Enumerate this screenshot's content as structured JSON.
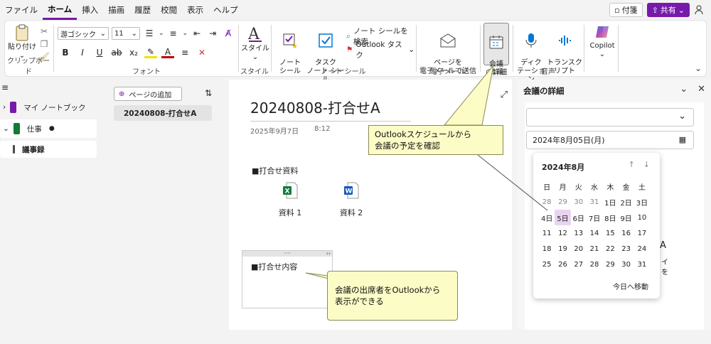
{
  "menu": {
    "items": [
      "ファイル",
      "ホーム",
      "挿入",
      "描画",
      "履歴",
      "校閲",
      "表示",
      "ヘルプ"
    ],
    "active_index": 1,
    "tag_label": "付箋",
    "share_label": "共有"
  },
  "ribbon": {
    "clipboard": {
      "paste": "貼り付け",
      "label": "クリップボード"
    },
    "font": {
      "family": "游ゴシック",
      "size": "11",
      "label": "フォント"
    },
    "style": {
      "button": "スタイル",
      "label": "スタイル"
    },
    "tags": {
      "note_tag": "ノート\nシール",
      "task_tag": "タスク\nノート シール",
      "search": "ノート シールを検索",
      "outlook_task": "Outlook タスク",
      "label": "ノート シール"
    },
    "email": {
      "button": "ページを\n電子メールで送信",
      "label": "電子メール"
    },
    "meeting": {
      "button": "会議\nの詳細",
      "label": "会議"
    },
    "voice": {
      "dictate": "ディク\nテーション",
      "transcribe": "トランスク\nリプト",
      "label": "音声"
    },
    "copilot": {
      "button": "Copilot"
    }
  },
  "nav": {
    "notebooks": [
      {
        "label": "マイ ノートブック",
        "color": "#7719aa"
      },
      {
        "label": "仕事",
        "color": "#0f7b35"
      }
    ],
    "section": "議事録",
    "section_color": "#4a4a4a"
  },
  "pages": {
    "add_label": "ページの追加",
    "items": [
      "20240808-打合せA"
    ]
  },
  "canvas": {
    "title": "20240808-打合せA",
    "date": "2025年9月7日",
    "time": "8:12",
    "section1": "■打合せ資料",
    "file1": "資料 1",
    "file2": "資料 2",
    "section2": "■打合せ内容"
  },
  "panel": {
    "title": "会議の詳細",
    "date_value": "2024年8月05日(月)",
    "partial1": "A",
    "partial2": "イ",
    "partial3": "を"
  },
  "calendar": {
    "month": "2024年8月",
    "weekdays": [
      "日",
      "月",
      "火",
      "水",
      "木",
      "金",
      "土"
    ],
    "days": [
      "28",
      "29",
      "30",
      "31",
      "1日",
      "2日",
      "3日",
      "4日",
      "5日",
      "6日",
      "7日",
      "8日",
      "9日",
      "10",
      "11",
      "12",
      "13",
      "14",
      "15",
      "16",
      "17",
      "18",
      "19",
      "20",
      "21",
      "22",
      "23",
      "24",
      "25",
      "26",
      "27",
      "28",
      "29",
      "30",
      "31"
    ],
    "today": "今日へ移動"
  },
  "callouts": {
    "top": "Outlookスケジュールから\n会議の予定を確認",
    "bottom": "会議の出席者をOutlookから\n表示ができる"
  },
  "colors": {
    "accent": "#7719aa",
    "excel": "#107c41",
    "word": "#185abd",
    "callout_bg": "#fcfcc6"
  }
}
